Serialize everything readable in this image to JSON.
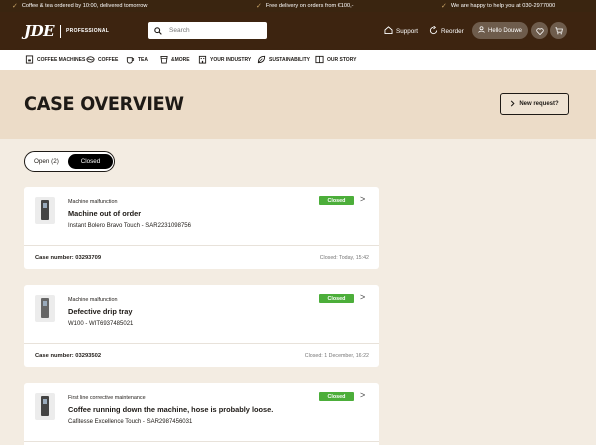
{
  "promo": [
    {
      "text": "Coffee & tea ordered by 10:00, delivered tomorrow"
    },
    {
      "text": "Free delivery on orders from €100,-"
    },
    {
      "text": "We are happy to help you at 030-2977000"
    }
  ],
  "header": {
    "logo_mark": "JDE",
    "logo_sub": "PROFESSIONAL",
    "search_placeholder": "Search",
    "support": "Support",
    "reorder": "Reorder",
    "hello": "Hello Douwe"
  },
  "nav": [
    {
      "label": "COFFEE MACHINES",
      "icon": "coffee-machine-icon"
    },
    {
      "label": "COFFEE",
      "icon": "coffee-bean-icon"
    },
    {
      "label": "TEA",
      "icon": "tea-cup-icon"
    },
    {
      "label": "&MORE",
      "icon": "cup-icon"
    },
    {
      "label": "YOUR INDUSTRY",
      "icon": "building-icon"
    },
    {
      "label": "SUSTAINABILITY",
      "icon": "leaf-icon"
    },
    {
      "label": "OUR STORY",
      "icon": "book-icon"
    }
  ],
  "page": {
    "title": "CASE OVERVIEW",
    "new_request": "New request?"
  },
  "toggle": {
    "open": "Open (2)",
    "closed": "Closed"
  },
  "cases": [
    {
      "category": "Machine malfunction",
      "title": "Machine out of order",
      "machine": "Instant Bolero Bravo Touch - SAR2231098756",
      "status": "Closed",
      "case_number": "Case number: 03293709",
      "closed_at": "Closed: Today, 15:42"
    },
    {
      "category": "Machine malfunction",
      "title": "Defective drip tray",
      "machine": "W100 - WIT6937485021",
      "status": "Closed",
      "case_number": "Case number: 03293502",
      "closed_at": "Closed: 1 December, 16:22"
    },
    {
      "category": "First line corrective maintenance",
      "title": "Coffee running down the machine, hose is probably loose.",
      "machine": "Cafitesse Excellence Touch - SAR2987456031",
      "status": "Closed"
    }
  ],
  "colors": {
    "header_bg": "#3d2410",
    "hero_bg": "#ecdcc8",
    "page_bg": "#f3ece2",
    "status_green": "#4cae3a"
  }
}
